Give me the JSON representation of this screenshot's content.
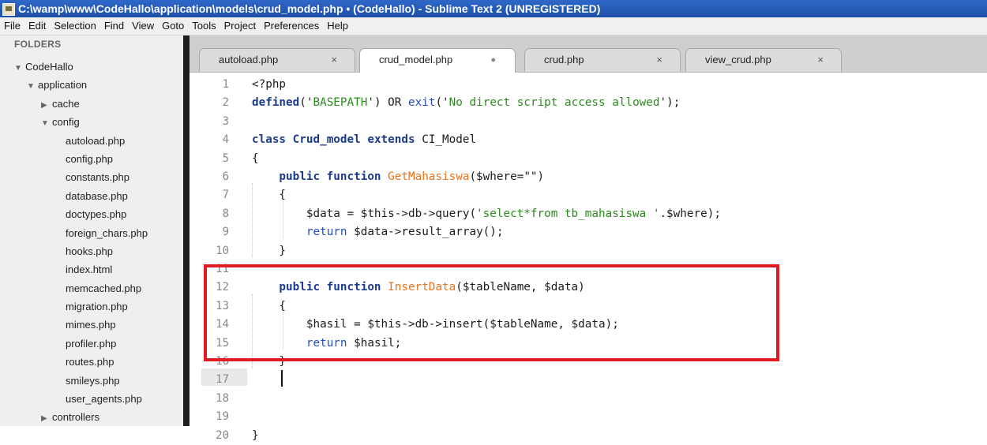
{
  "window": {
    "title": "C:\\wamp\\www\\CodeHallo\\application\\models\\crud_model.php • (CodeHallo) - Sublime Text 2 (UNREGISTERED)"
  },
  "menu": [
    "File",
    "Edit",
    "Selection",
    "Find",
    "View",
    "Goto",
    "Tools",
    "Project",
    "Preferences",
    "Help"
  ],
  "sidebar": {
    "header": "FOLDERS",
    "tree": [
      {
        "label": "CodeHallo",
        "kind": "folder",
        "expanded": true
      },
      {
        "label": "application",
        "kind": "folder",
        "expanded": true
      },
      {
        "label": "cache",
        "kind": "folder",
        "expanded": false
      },
      {
        "label": "config",
        "kind": "folder",
        "expanded": true
      },
      {
        "label": "autoload.php",
        "kind": "file"
      },
      {
        "label": "config.php",
        "kind": "file"
      },
      {
        "label": "constants.php",
        "kind": "file"
      },
      {
        "label": "database.php",
        "kind": "file"
      },
      {
        "label": "doctypes.php",
        "kind": "file"
      },
      {
        "label": "foreign_chars.php",
        "kind": "file"
      },
      {
        "label": "hooks.php",
        "kind": "file"
      },
      {
        "label": "index.html",
        "kind": "file"
      },
      {
        "label": "memcached.php",
        "kind": "file"
      },
      {
        "label": "migration.php",
        "kind": "file"
      },
      {
        "label": "mimes.php",
        "kind": "file"
      },
      {
        "label": "profiler.php",
        "kind": "file"
      },
      {
        "label": "routes.php",
        "kind": "file"
      },
      {
        "label": "smileys.php",
        "kind": "file"
      },
      {
        "label": "user_agents.php",
        "kind": "file"
      },
      {
        "label": "controllers",
        "kind": "folder",
        "expanded": false
      }
    ]
  },
  "tabs": [
    {
      "label": "autoload.php",
      "active": false,
      "close": "×"
    },
    {
      "label": "crud_model.php",
      "active": true,
      "dirty": "●"
    },
    {
      "label": "crud.php",
      "active": false,
      "close": "×"
    },
    {
      "label": "view_crud.php",
      "active": false,
      "close": "×"
    }
  ],
  "editor": {
    "line_numbers": [
      "1",
      "2",
      "3",
      "4",
      "5",
      "6",
      "7",
      "8",
      "9",
      "10",
      "11",
      "12",
      "13",
      "14",
      "15",
      "16",
      "17",
      "18",
      "19",
      "20"
    ],
    "lines": [
      [
        {
          "t": "<?php",
          "c": "var"
        }
      ],
      [
        {
          "t": "defined",
          "c": "kw"
        },
        {
          "t": "('",
          "c": "var"
        },
        {
          "t": "BASEPATH",
          "c": "str"
        },
        {
          "t": "') OR ",
          "c": "var"
        },
        {
          "t": "exit",
          "c": "kw2"
        },
        {
          "t": "('",
          "c": "var"
        },
        {
          "t": "No direct script access allowed",
          "c": "str"
        },
        {
          "t": "');",
          "c": "var"
        }
      ],
      [],
      [
        {
          "t": "class ",
          "c": "kw"
        },
        {
          "t": "Crud_model ",
          "c": "kw"
        },
        {
          "t": "extends ",
          "c": "kw"
        },
        {
          "t": "CI_Model",
          "c": "var"
        }
      ],
      [
        {
          "t": "{",
          "c": "var"
        }
      ],
      [
        {
          "t": "    public function ",
          "c": "kw"
        },
        {
          "t": "GetMahasiswa",
          "c": "fn"
        },
        {
          "t": "($where=\"\")",
          "c": "var"
        }
      ],
      [
        {
          "t": "    {",
          "c": "var"
        }
      ],
      [
        {
          "t": "        $data = $this->db->query(",
          "c": "var"
        },
        {
          "t": "'select*from tb_mahasiswa '",
          "c": "str"
        },
        {
          "t": ".$where);",
          "c": "var"
        }
      ],
      [
        {
          "t": "        ",
          "c": "var"
        },
        {
          "t": "return ",
          "c": "kw2"
        },
        {
          "t": "$data->result_array();",
          "c": "var"
        }
      ],
      [
        {
          "t": "    }",
          "c": "var"
        }
      ],
      [],
      [
        {
          "t": "    public function ",
          "c": "kw"
        },
        {
          "t": "InsertData",
          "c": "fn"
        },
        {
          "t": "($tableName, $data)",
          "c": "var"
        }
      ],
      [
        {
          "t": "    {",
          "c": "var"
        }
      ],
      [
        {
          "t": "        $hasil = $this->db->insert($tableName, $data);",
          "c": "var"
        }
      ],
      [
        {
          "t": "        ",
          "c": "var"
        },
        {
          "t": "return ",
          "c": "kw2"
        },
        {
          "t": "$hasil;",
          "c": "var"
        }
      ],
      [
        {
          "t": "    }",
          "c": "var"
        }
      ],
      [],
      [],
      [],
      [
        {
          "t": "}",
          "c": "var"
        }
      ]
    ]
  },
  "colors": {
    "title_bar": "#1d4fa6",
    "highlight_box": "#e11b22",
    "keyword": "#1b3b8f",
    "function_name": "#e8731f",
    "string": "#2a8a1c"
  }
}
